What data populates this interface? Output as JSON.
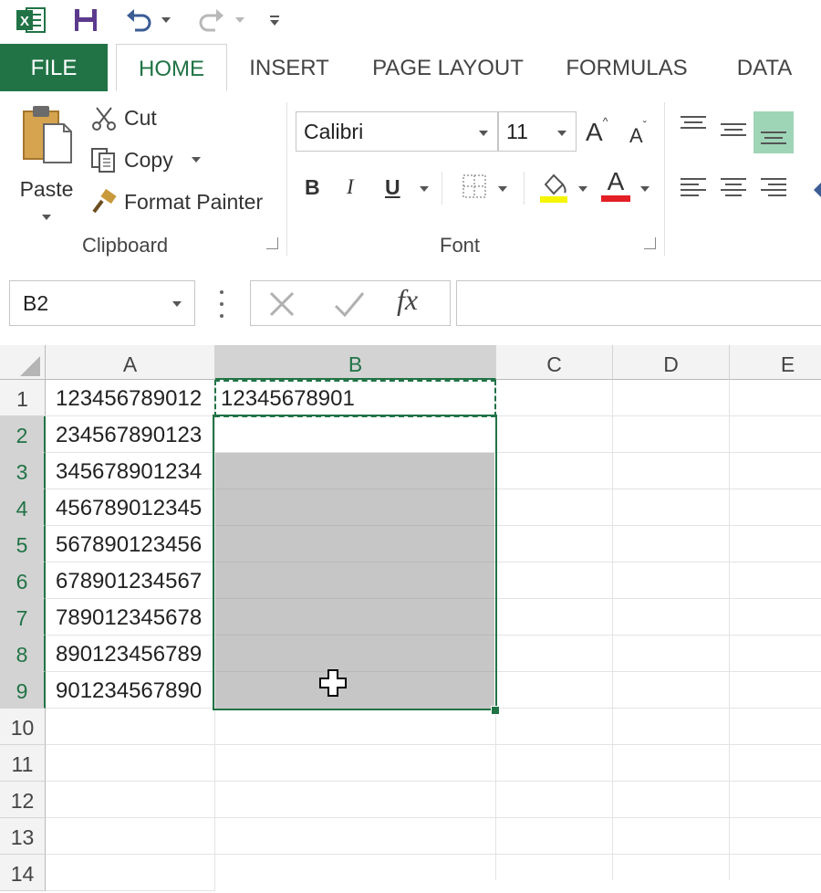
{
  "quick_access": {
    "app_icon": "excel-icon",
    "save_icon": "save-icon",
    "undo_icon": "undo-icon",
    "redo_icon": "redo-icon",
    "customize_icon": "customize-qat-icon"
  },
  "tabs": [
    {
      "label": "FILE"
    },
    {
      "label": "HOME"
    },
    {
      "label": "INSERT"
    },
    {
      "label": "PAGE LAYOUT"
    },
    {
      "label": "FORMULAS"
    },
    {
      "label": "DATA"
    }
  ],
  "ribbon": {
    "clipboard": {
      "paste_label": "Paste",
      "cut_label": "Cut",
      "copy_label": "Copy",
      "format_painter_label": "Format Painter",
      "group_label": "Clipboard"
    },
    "font": {
      "font_name": "Calibri",
      "font_size": "11",
      "bold_label": "B",
      "italic_label": "I",
      "underline_label": "U",
      "font_color_letter": "A",
      "grow_letter": "A",
      "shrink_letter": "A",
      "group_label": "Font",
      "highlight_color": "#f5f500",
      "font_color": "#e31e24"
    }
  },
  "formula_bar": {
    "name_box": "B2",
    "fx_label": "fx",
    "formula": ""
  },
  "grid": {
    "columns": [
      "A",
      "B",
      "C",
      "D",
      "E"
    ],
    "rows": [
      "1",
      "2",
      "3",
      "4",
      "5",
      "6",
      "7",
      "8",
      "9",
      "10",
      "11",
      "12",
      "13",
      "14"
    ],
    "column_a": [
      "123456789012",
      "234567890123",
      "345678901234",
      "456789012345",
      "567890123456",
      "678901234567",
      "789012345678",
      "890123456789",
      "901234567890"
    ],
    "b1": "12345678901",
    "active_cell": "B2",
    "accent_color": "#217346",
    "selection_fill": "#c6c6c6"
  }
}
